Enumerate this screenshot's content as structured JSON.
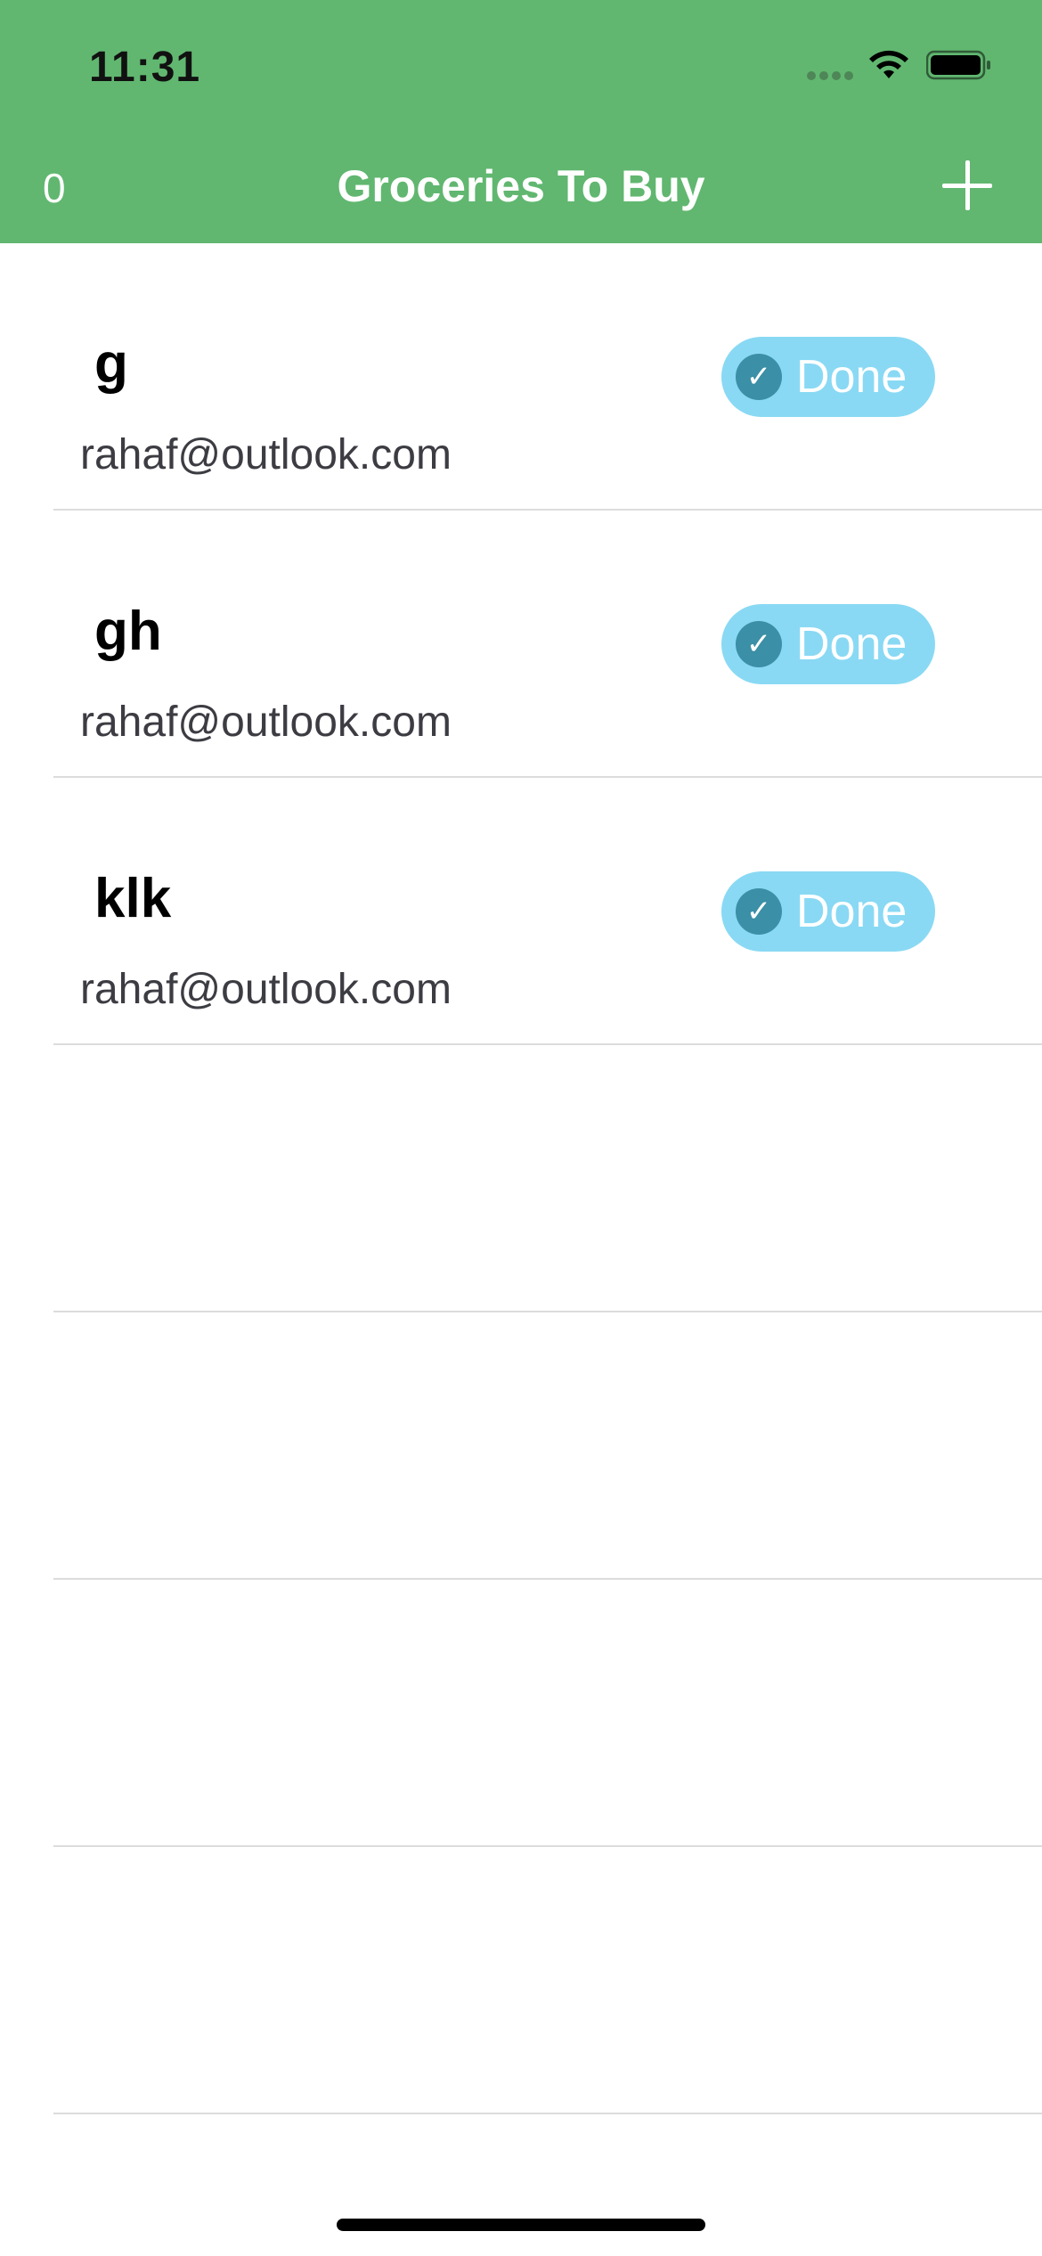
{
  "status_bar": {
    "time": "11:31"
  },
  "nav": {
    "left_count": "0",
    "title": "Groceries To Buy",
    "add_icon": "plus-icon"
  },
  "colors": {
    "header_bg": "#61b770",
    "done_bg": "#89d9f4",
    "done_icon_bg": "#3b8fa6"
  },
  "items": [
    {
      "title": "g",
      "subtitle": "rahaf@outlook.com",
      "done_label": "Done"
    },
    {
      "title": "gh",
      "subtitle": "rahaf@outlook.com",
      "done_label": "Done"
    },
    {
      "title": "klk",
      "subtitle": "rahaf@outlook.com",
      "done_label": "Done"
    }
  ]
}
